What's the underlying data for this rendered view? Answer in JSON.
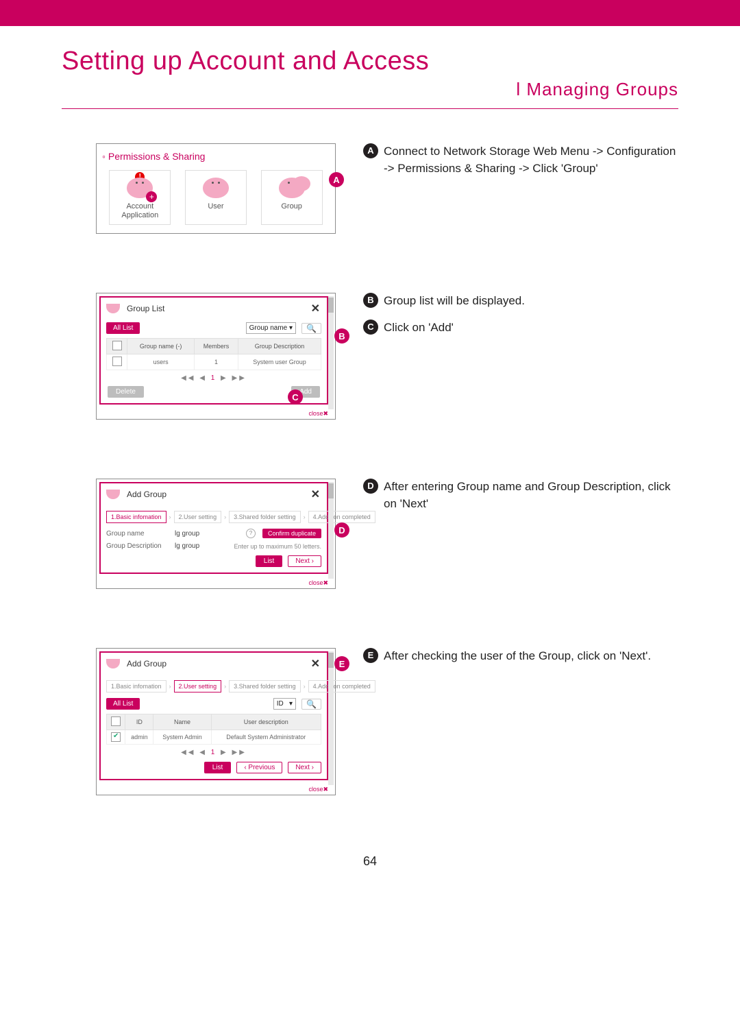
{
  "top": {
    "title": "Setting up Account and Access",
    "subtitle": "l  Managing Groups"
  },
  "page_number": "64",
  "step_a": {
    "text": "Connect to Network Storage Web Menu -> Configuration -> Permissions & Sharing -> Click 'Group'",
    "panel_title": "Permissions & Sharing",
    "cards": {
      "account": "Account Application",
      "user": "User",
      "group": "Group"
    }
  },
  "step_b": {
    "text": "Group list will be displayed."
  },
  "step_c": {
    "text": "Click on 'Add'"
  },
  "group_list": {
    "title": "Group List",
    "all_list": "All List",
    "filter": "Group name ▾",
    "cols": {
      "name": "Group name (-)",
      "members": "Members",
      "desc": "Group Description"
    },
    "row": {
      "name": "users",
      "members": "1",
      "desc": "System user Group"
    },
    "delete": "Delete",
    "add": "Add",
    "close": "close✖"
  },
  "step_d": {
    "text": "After entering Group name and Group Description, click on 'Next'"
  },
  "add_group": {
    "title": "Add Group",
    "crumbs": {
      "s1": "1.Basic infomation",
      "s2": "2.User setting",
      "s3": "3.Shared folder setting",
      "s4": "4.Addition completed"
    },
    "field_name": "Group name",
    "field_desc": "Group Description",
    "val_name": "lg group",
    "val_desc": "lg group",
    "confirm": "Confirm duplicate",
    "hint": "Enter up to maximum 50 letters.",
    "list": "List",
    "next": "Next ›",
    "prev": "‹ Previous",
    "close": "close✖"
  },
  "step_e": {
    "text": "After checking the user of the Group, click on 'Next'."
  },
  "user_setting": {
    "title": "Add Group",
    "all_list": "All List",
    "id_filter": "ID",
    "cols": {
      "id": "ID",
      "name": "Name",
      "desc": "User description"
    },
    "row": {
      "id": "admin",
      "name": "System Admin",
      "desc": "Default System Administrator"
    }
  }
}
